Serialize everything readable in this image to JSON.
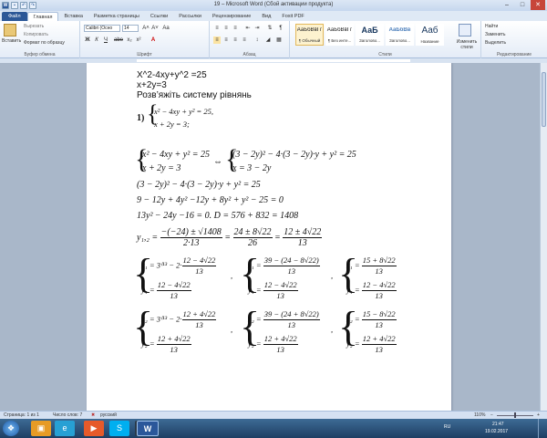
{
  "window": {
    "title": "19 – Microsoft Word (Сбой активации продукта)",
    "minimize": "–",
    "maximize": "□",
    "close": "✕"
  },
  "quick_access": {
    "word": "W",
    "save": "▪",
    "undo": "↶",
    "redo": "↷"
  },
  "tabs": {
    "file": "Файл",
    "home": "Главная",
    "insert": "Вставка",
    "layout": "Разметка страницы",
    "refs": "Ссылки",
    "mail": "Рассылки",
    "review": "Рецензирование",
    "view": "Вид",
    "foxit": "Foxit PDF"
  },
  "ribbon": {
    "clipboard": {
      "paste": "Вставить",
      "cut": "Вырезать",
      "copy": "Копировать",
      "format": "Формат по образцу",
      "label": "Буфер обмена"
    },
    "font": {
      "name": "Calibri (Осно",
      "size": "14",
      "label": "Шрифт",
      "bold": "Ж",
      "italic": "К",
      "underline": "Ч",
      "strike": "abe",
      "sub": "x₂",
      "sup": "x²",
      "grow": "A˄",
      "shrink": "A˅",
      "clear": "Aa",
      "color": "A"
    },
    "paragraph": {
      "label": "Абзац"
    },
    "styles": {
      "label": "Стили",
      "items": [
        {
          "preview": "АаБбВвГг",
          "name": "¶ Обычный"
        },
        {
          "preview": "АаБбВвГг",
          "name": "¶ Без инте..."
        },
        {
          "preview": "АаБ",
          "name": "Заголово..."
        },
        {
          "preview": "АаБбВв",
          "name": "Заголово..."
        },
        {
          "preview": "Ааб",
          "name": "Название"
        }
      ],
      "change": "Изменить стили"
    },
    "editing": {
      "find": "Найти",
      "replace": "Заменить",
      "select": "Выделить",
      "label": "Редактирование"
    }
  },
  "document": {
    "line1": "X^2-4xy+y^2 =25",
    "line2": "x+2y=3",
    "line3": "Розв’яжіть систему рівнянь",
    "task_num": "1)",
    "task_eq1": "x² − 4xy + y² = 25,",
    "task_eq2": "x + 2y = 3;",
    "sys_left_1": "x² − 4xy + y² = 25",
    "sys_left_2": "x + 2y = 3",
    "equiv": "⇔",
    "sys_right_1": "(3 − 2y)² − 4·(3 − 2y)·y + y² = 25",
    "sys_right_2": "x = 3 − 2y",
    "step1": "(3 − 2y)² − 4·(3 − 2y)·y + y² = 25",
    "step2": "9 − 12y + 4y² −12y + 8y² + y² − 25 = 0",
    "step3": "13y² − 24y −16 = 0.   D = 576 + 832 = 1408",
    "roots_lhs": "y₁,₂ =",
    "roots_f1_num": "−(−24) ± √1408",
    "roots_f1_den": "2·13",
    "roots_eq": "=",
    "roots_f2_num": "24 ± 8√22",
    "roots_f2_den": "26",
    "roots_f3_num": "12 ± 4√22",
    "roots_f3_den": "13",
    "den13": "13",
    "s1_x1_pre": "x₁ = 3⁽¹³ − 2·",
    "s1_x1_num": "12 − 4√22",
    "s1_y1_pre": "y₁ =",
    "s1_y1_num": "12 − 4√22",
    "s2_x1_pre": "x₁ =",
    "s2_x1_num": "39 − (24 − 8√22)",
    "s2_y1_pre": "y₁ =",
    "s2_y1_num": "12 − 4√22",
    "s3_x1_pre": "x₁ =",
    "s3_x1_num": "15 + 8√22",
    "s3_y1_pre": "y₁ =",
    "s3_y1_num": "12 − 4√22",
    "s1_x2_pre": "x₂ = 3⁽¹³ − 2·",
    "s1_x2_num": "12 + 4√22",
    "s1_y2_pre": "y₂ =",
    "s1_y2_num": "12 + 4√22",
    "s2_x2_pre": "x₂ =",
    "s2_x2_num": "39 − (24 + 8√22)",
    "s2_y2_pre": "y₂ =",
    "s2_y2_num": "12 + 4√22",
    "s3_x2_pre": "x₂ =",
    "s3_x2_num": "15 − 8√22",
    "s3_y2_pre": "y₂ =",
    "s3_y2_num": "12 + 4√22",
    "comma": ","
  },
  "status": {
    "page": "Страница: 1 из 1",
    "words": "Число слов: 7",
    "lang": "русский",
    "zoom": "110%"
  },
  "taskbar": {
    "lang": "RU",
    "time": "21:47",
    "date": "19.02.2017"
  }
}
